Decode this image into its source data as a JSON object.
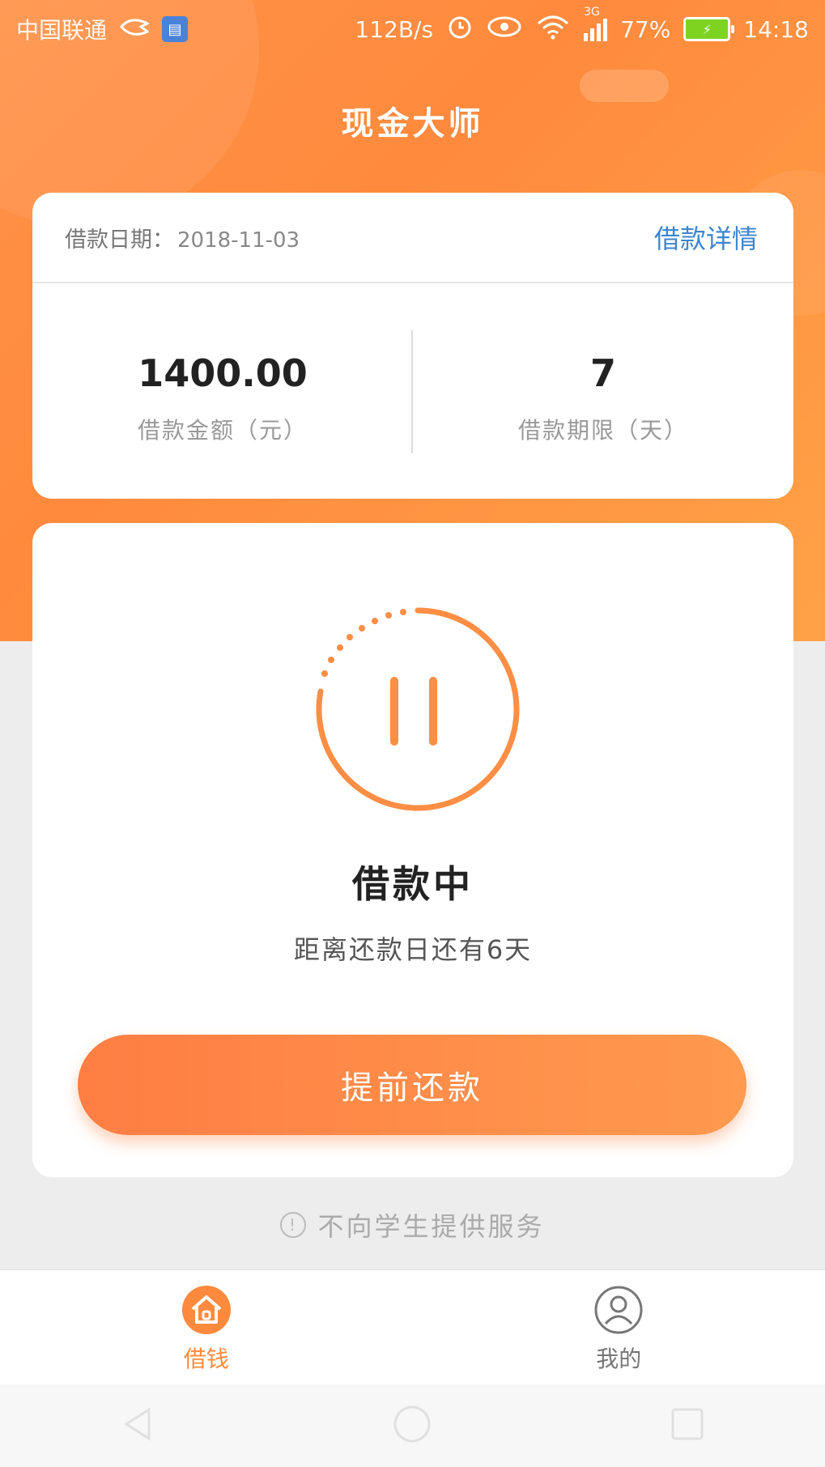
{
  "status_bar": {
    "carrier": "中国联通",
    "speed": "112B/s",
    "network": "3G",
    "battery": "77%",
    "time": "14:18"
  },
  "app": {
    "title": "现金大师"
  },
  "loan_info": {
    "date_label": "借款日期：",
    "date_value": "2018-11-03",
    "details_link": "借款详情",
    "amount_value": "1400.00",
    "amount_caption": "借款金额（元）",
    "term_value": "7",
    "term_caption": "借款期限（天）"
  },
  "loan_status": {
    "title": "借款中",
    "countdown": "距离还款日还有6天",
    "repay_button": "提前还款"
  },
  "notice": {
    "text": "不向学生提供服务"
  },
  "tabs": [
    {
      "label": "借钱",
      "icon": "home-icon",
      "active": true
    },
    {
      "label": "我的",
      "icon": "user-icon",
      "active": false
    }
  ],
  "colors": {
    "brand_orange": "#ff8a3d",
    "link_blue": "#3d86cf",
    "battery_green": "#7ed321"
  }
}
